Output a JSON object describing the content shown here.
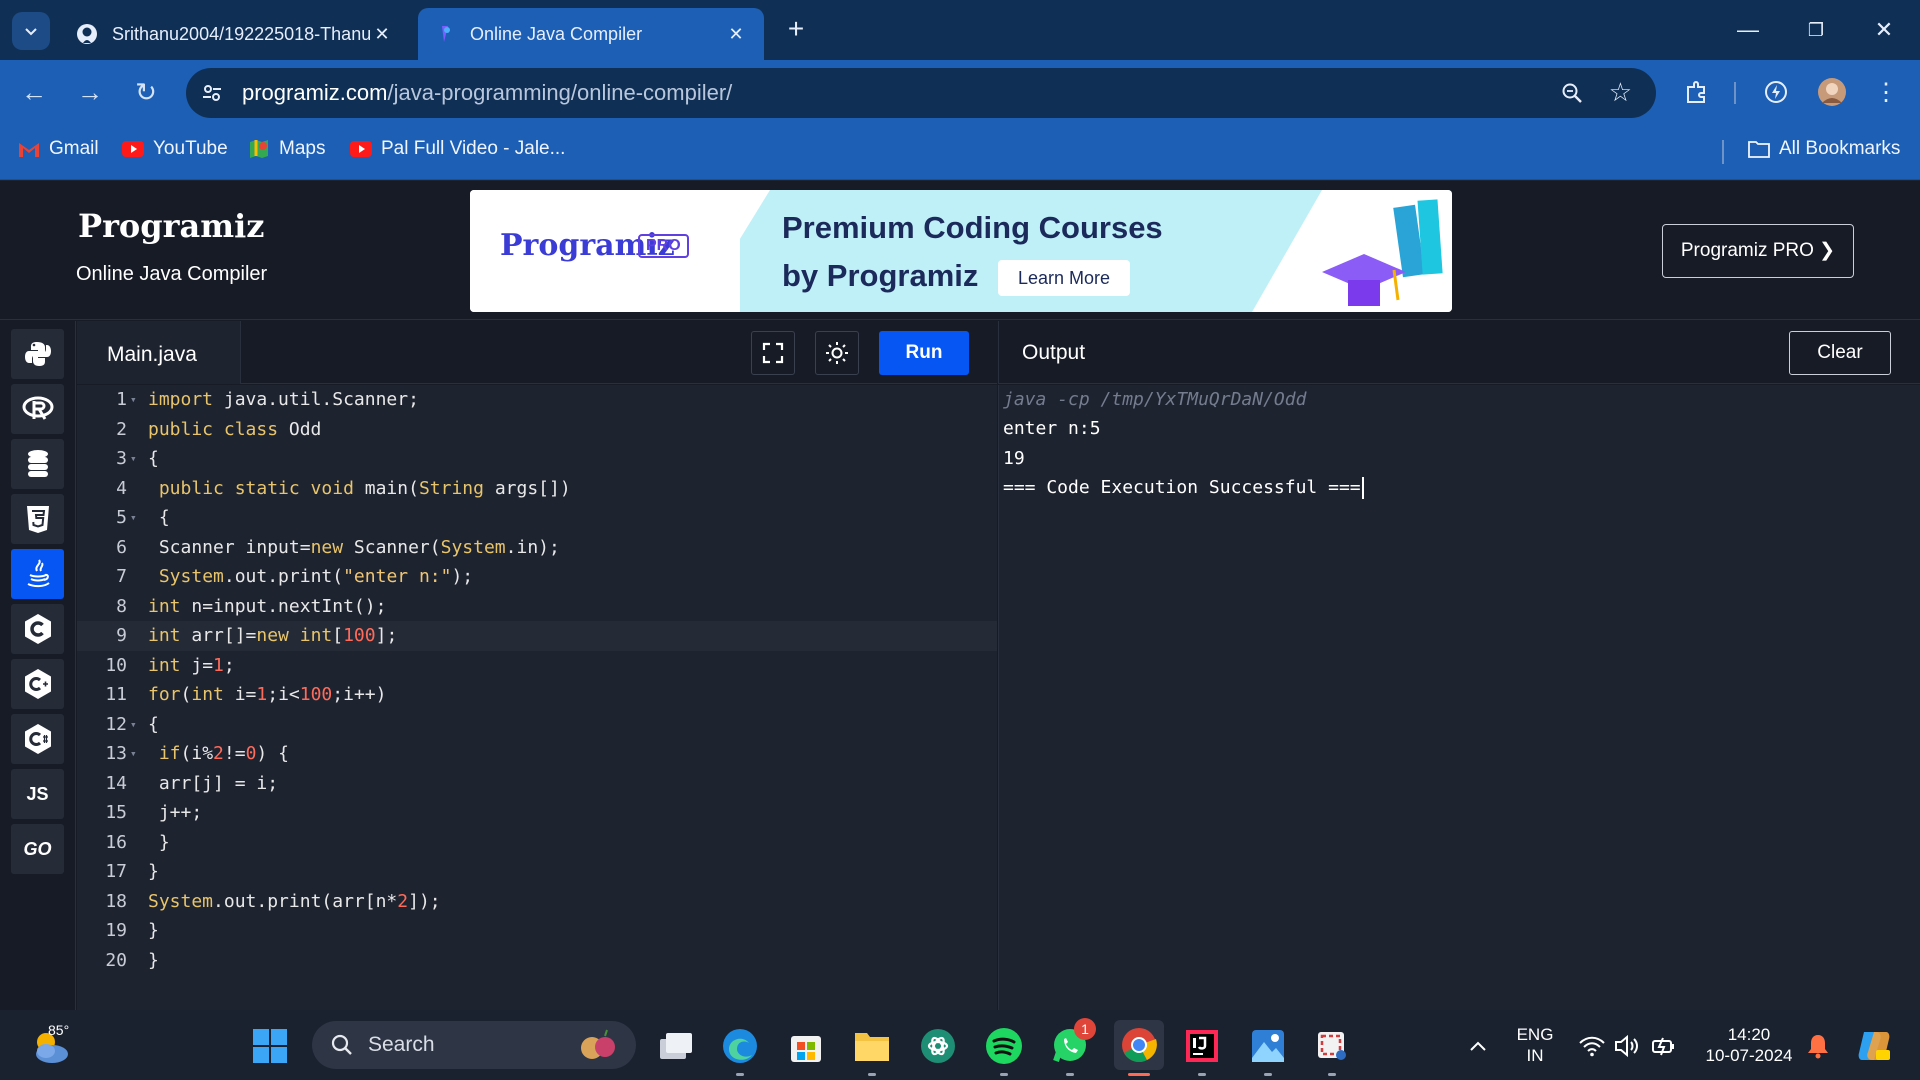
{
  "browser": {
    "tabs": [
      {
        "title": "Srithanu2004/192225018-Thanu",
        "active": false
      },
      {
        "title": "Online Java Compiler",
        "active": true
      }
    ],
    "url_host": "programiz.com",
    "url_path": "/java-programming/online-compiler/",
    "bookmarks": [
      {
        "label": "Gmail",
        "icon": "gmail-icon"
      },
      {
        "label": "YouTube",
        "icon": "youtube-icon"
      },
      {
        "label": "Maps",
        "icon": "maps-icon"
      },
      {
        "label": "Pal Full Video - Jale...",
        "icon": "youtube-icon"
      }
    ],
    "all_bookmarks": "All Bookmarks"
  },
  "site": {
    "logo": "Programiz",
    "subtitle": "Online Java Compiler",
    "ad": {
      "logo": "Programiz",
      "badge": "PRO",
      "line1": "Premium Coding Courses",
      "line2": "by Programiz",
      "button": "Learn More"
    },
    "pro_button": "Programiz PRO ❯"
  },
  "sidebar": {
    "languages": [
      "python",
      "r",
      "sql",
      "html",
      "java",
      "c",
      "cpp",
      "csharp",
      "JS",
      "GO"
    ],
    "active": "java"
  },
  "editor": {
    "filename": "Main.java",
    "run_label": "Run",
    "lines": [
      "import java.util.Scanner;",
      "public class Odd",
      "{",
      " public static void main(String args[])",
      " {",
      " Scanner input=new Scanner(System.in);",
      " System.out.print(\"enter n:\");",
      "int n=input.nextInt();",
      "int arr[]=new int[100];",
      "int j=1;",
      "for(int i=1;i<100;i++)",
      "{",
      " if(i%2!=0) {",
      " arr[j] = i;",
      " j++;",
      " }",
      "}",
      "System.out.print(arr[n*2]);",
      "}",
      "}"
    ]
  },
  "output": {
    "title": "Output",
    "clear_label": "Clear",
    "command": "java -cp /tmp/YxTMuQrDaN/Odd",
    "lines": [
      "enter n:5",
      "19",
      "=== Code Execution Successful ==="
    ]
  },
  "taskbar": {
    "temperature": "85°",
    "search_placeholder": "Search",
    "whatsapp_badge": "1",
    "language": "ENG",
    "region": "IN",
    "time": "14:20",
    "date": "10-07-2024"
  }
}
